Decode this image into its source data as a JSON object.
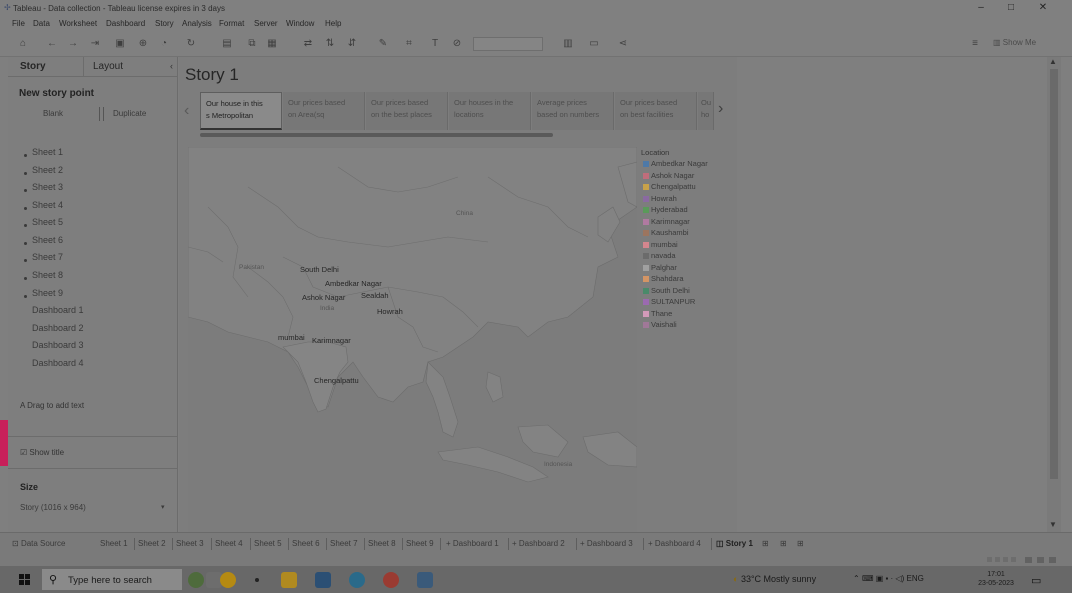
{
  "window": {
    "title": "Tableau - Data collection - Tableau license expires in 3 days",
    "controls": [
      "–",
      "□",
      "✕"
    ]
  },
  "menu": [
    "File",
    "Data",
    "Worksheet",
    "Dashboard",
    "Story",
    "Analysis",
    "Format",
    "Server",
    "Window",
    "Help"
  ],
  "toolbar": {
    "show_me": "Show Me"
  },
  "left_panel": {
    "tabs": [
      "Story",
      "Layout"
    ],
    "new_story_point": "New story point",
    "blank": "Blank",
    "duplicate": "Duplicate",
    "sheets": [
      "Sheet 1",
      "Sheet 2",
      "Sheet 3",
      "Sheet 4",
      "Sheet 5",
      "Sheet 6",
      "Sheet 7",
      "Sheet 8",
      "Sheet 9"
    ],
    "dashboards": [
      "Dashboard 1",
      "Dashboard 2",
      "Dashboard 3",
      "Dashboard 4"
    ],
    "drag_text": "Drag to add text",
    "show_title": "Show title",
    "size_label": "Size",
    "size_value": "Story (1016 x 964)"
  },
  "story": {
    "title": "Story 1",
    "points": [
      {
        "l1": "Our house in this",
        "l2": "s Metropolitan"
      },
      {
        "l1": "Our prices based",
        "l2": "on Area(sq"
      },
      {
        "l1": "Our prices based",
        "l2": "on the best places"
      },
      {
        "l1": "Our houses in the",
        "l2": "locations"
      },
      {
        "l1": "Average prices",
        "l2": "based on numbers"
      },
      {
        "l1": "Our prices based",
        "l2": "on best facilities"
      },
      {
        "l1": "Ou",
        "l2": "ho"
      }
    ]
  },
  "map": {
    "city_labels": [
      "South Delhi",
      "Ambedkar Nagar",
      "Ashok Nagar",
      "Howrah",
      "Sealdah",
      "mumbai",
      "Karimnagar",
      "Chengalpattu"
    ],
    "country_labels": [
      "Pakistan",
      "India",
      "China",
      "Indonesia"
    ]
  },
  "legend": {
    "title": "Location",
    "items": [
      {
        "label": "Ambedkar Nagar",
        "color": "#4e79a7"
      },
      {
        "label": "Ashok Nagar",
        "color": "#c06d7b"
      },
      {
        "label": "Chengalpattu",
        "color": "#c8a24a"
      },
      {
        "label": "Howrah",
        "color": "#8a6aa1"
      },
      {
        "label": "Hyderabad",
        "color": "#5a9a5a"
      },
      {
        "label": "Karimnagar",
        "color": "#b07aa1"
      },
      {
        "label": "Kaushambi",
        "color": "#9c755f"
      },
      {
        "label": "mumbai",
        "color": "#d4868e"
      },
      {
        "label": "navada",
        "color": "#6b6b6b"
      },
      {
        "label": "Palghar",
        "color": "#a0a0a0"
      },
      {
        "label": "Shahdara",
        "color": "#d49565"
      },
      {
        "label": "South Delhi",
        "color": "#4a8a6a"
      },
      {
        "label": "SULTANPUR",
        "color": "#9b6ab0"
      },
      {
        "label": "Thane",
        "color": "#d39ab9"
      },
      {
        "label": "Vaishali",
        "color": "#a07898"
      }
    ]
  },
  "sheet_tabs": [
    "Data Source",
    "Sheet 1",
    "Sheet 2",
    "Sheet 3",
    "Sheet 4",
    "Sheet 5",
    "Sheet 6",
    "Sheet 7",
    "Sheet 8",
    "Sheet 9",
    "Dashboard 1",
    "Dashboard 2",
    "Dashboard 3",
    "Dashboard 4",
    "Story 1"
  ],
  "taskbar": {
    "search_placeholder": "Type here to search",
    "weather": "33°C  Mostly sunny",
    "language": "ENG",
    "time": "17:01",
    "date": "23-05-2023"
  }
}
